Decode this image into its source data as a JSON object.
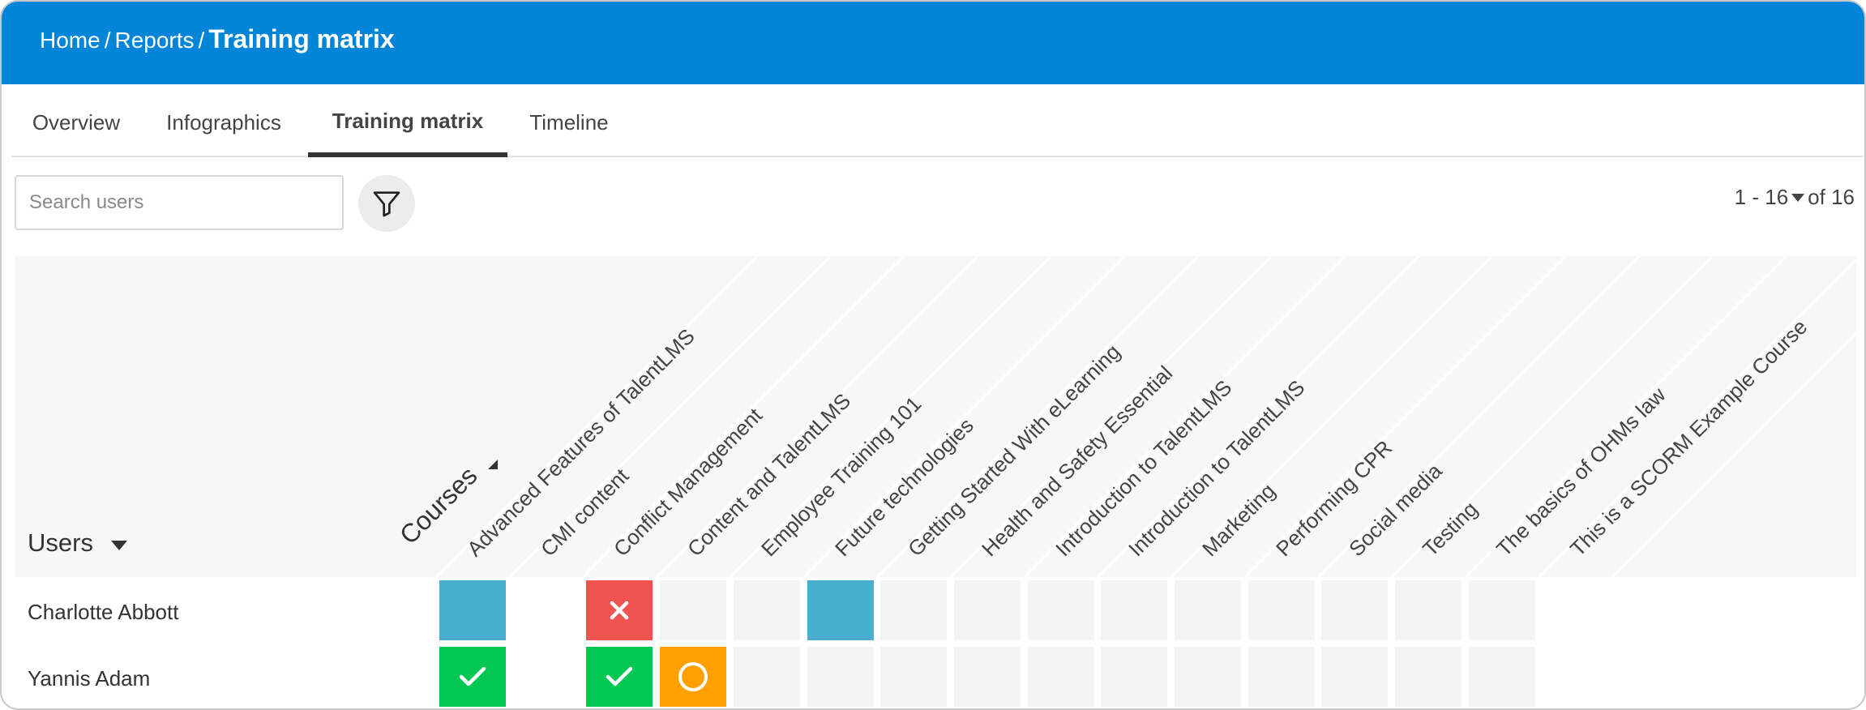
{
  "breadcrumb": {
    "home": "Home",
    "reports": "Reports",
    "current": "Training matrix",
    "separator": "/"
  },
  "tabs": [
    {
      "label": "Overview",
      "active": false
    },
    {
      "label": "Infographics",
      "active": false
    },
    {
      "label": "Training matrix",
      "active": true
    },
    {
      "label": "Timeline",
      "active": false
    }
  ],
  "search": {
    "placeholder": "Search users",
    "value": ""
  },
  "filter": {
    "icon": "filter-icon"
  },
  "pager": {
    "range": "1 - 16",
    "total": "of 16"
  },
  "matrix": {
    "users_header": "Users",
    "courses_header": "Courses",
    "courses": [
      "Advanced Features of TalentLMS",
      "CMI content",
      "Conflict Management",
      "Content and TalentLMS",
      "Employee Training 101",
      "Future technologies",
      "Getting Started With eLearning",
      "Health and Safety Essential",
      "Introduction to TalentLMS",
      "Introduction to TalentLMS",
      "Marketing",
      "Performing CPR",
      "Social media",
      "Testing",
      "The basics of OHMs law",
      "This is a SCORM Example Course"
    ],
    "users": [
      {
        "name": "Charlotte Abbott",
        "statuses": [
          "enrolled",
          "none",
          "failed",
          "empty",
          "empty",
          "enrolled",
          "empty",
          "empty",
          "empty",
          "empty",
          "empty",
          "empty",
          "empty",
          "empty",
          "empty",
          "none"
        ]
      },
      {
        "name": "Yannis Adam",
        "statuses": [
          "completed",
          "none",
          "completed",
          "in-progress",
          "empty",
          "empty",
          "empty",
          "empty",
          "empty",
          "empty",
          "empty",
          "empty",
          "empty",
          "empty",
          "empty",
          "none"
        ]
      }
    ]
  },
  "colors": {
    "header": "#0085d8",
    "completed": "#00c853",
    "failed": "#ef5350",
    "in_progress": "#ffa000",
    "enrolled": "#4aafcf"
  }
}
